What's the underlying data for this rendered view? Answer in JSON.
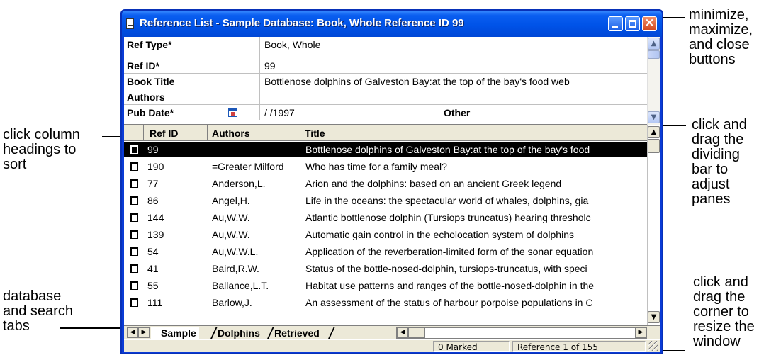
{
  "annotations": {
    "window_buttons": [
      "minimize,",
      "maximize,",
      "and close",
      "buttons"
    ],
    "sort_columns": [
      "click column",
      "headings to",
      "sort"
    ],
    "resize_panes": [
      "click and",
      "drag the",
      "dividing",
      "bar to",
      "adjust",
      "panes"
    ],
    "tabs": [
      "database",
      "and search",
      "tabs"
    ],
    "resize_window": [
      "click and",
      "drag the",
      "corner to",
      "resize the",
      "window"
    ]
  },
  "window": {
    "title": "Reference List - Sample Database: Book, Whole Reference ID 99",
    "buttons": {
      "minimize": "minimize-button",
      "maximize": "maximize-button",
      "close": "×"
    }
  },
  "record": {
    "fields": [
      {
        "label": "Ref Type*",
        "value": "Book, Whole"
      },
      {
        "label": "Ref ID*",
        "value": "99"
      },
      {
        "label": "Book Title",
        "value": "Bottlenose dolphins of Galveston Bay:at the top of the bay's food web"
      },
      {
        "label": "Authors",
        "value": ""
      },
      {
        "label": "Pub Date*",
        "value": "/ /1997",
        "extra": "Other"
      }
    ]
  },
  "list": {
    "columns": [
      "Ref ID",
      "Authors",
      "Title"
    ],
    "rows": [
      {
        "id": "99",
        "author": "",
        "title": "Bottlenose dolphins of Galveston Bay:at the top of the bay's food"
      },
      {
        "id": "190",
        "author": "=Greater Milford",
        "title": "Who has time for a family meal?"
      },
      {
        "id": "77",
        "author": "Anderson,L.",
        "title": "Arion and the dolphins: based on an ancient Greek legend"
      },
      {
        "id": "86",
        "author": "Angel,H.",
        "title": "Life in the oceans: the spectacular world of whales, dolphins, gia"
      },
      {
        "id": "144",
        "author": "Au,W.W.",
        "title": "Atlantic bottlenose dolphin (Tursiops truncatus) hearing thresholc"
      },
      {
        "id": "139",
        "author": "Au,W.W.",
        "title": "Automatic gain control in the echolocation system of dolphins"
      },
      {
        "id": "54",
        "author": "Au,W.W.L.",
        "title": "Application of the reverberation-limited form of the sonar equation"
      },
      {
        "id": "41",
        "author": "Baird,R.W.",
        "title": "Status of the bottle-nosed-dolphin, tursiops-truncatus, with speci"
      },
      {
        "id": "55",
        "author": "Ballance,L.T.",
        "title": "Habitat use patterns and ranges of the bottle-nosed-dolphin in the"
      },
      {
        "id": "111",
        "author": "Barlow,J.",
        "title": "An assessment of the status of harbour porpoise populations in C"
      }
    ]
  },
  "tabs": [
    "Sample",
    "Dolphins",
    "Retrieved"
  ],
  "status": {
    "marked": "0 Marked",
    "position": "Reference 1 of 155"
  },
  "colors": {
    "titlebar": "#0053e8",
    "selection": "#000000",
    "close_button": "#d2461e"
  }
}
